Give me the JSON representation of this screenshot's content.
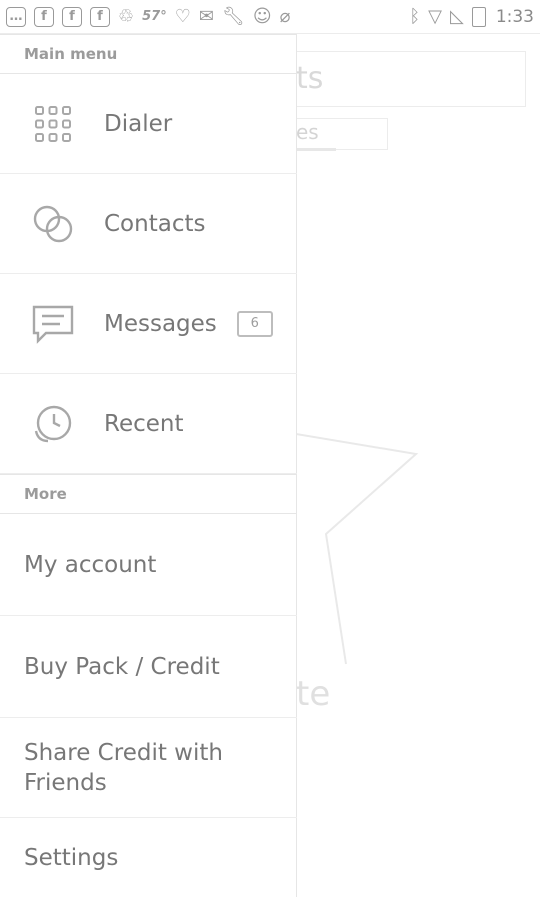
{
  "status_bar": {
    "left_icons": [
      "chat-icon",
      "facebook-icon",
      "facebook-icon",
      "facebook-icon",
      "recycle-icon",
      "temperature-icon",
      "heart-icon",
      "mail-icon",
      "wrench-icon",
      "messenger-icon",
      "pin-icon"
    ],
    "temperature": "57°",
    "time": "1:33"
  },
  "background": {
    "title_fragment": "ts",
    "tab_fragment": "es",
    "hint_fragment": "te"
  },
  "drawer": {
    "main_menu_header": "Main menu",
    "main_items": [
      {
        "label": "Dialer",
        "icon": "dialpad-icon"
      },
      {
        "label": "Contacts",
        "icon": "contacts-icon"
      },
      {
        "label": "Messages",
        "icon": "message-icon",
        "badge": "6"
      },
      {
        "label": "Recent",
        "icon": "recent-calls-icon"
      }
    ],
    "more_header": "More",
    "more_items": [
      {
        "label": "My account"
      },
      {
        "label": "Buy Pack / Credit"
      },
      {
        "label": "Share Credit with Friends"
      },
      {
        "label": "Settings"
      }
    ]
  },
  "colors": {
    "text": "#777777",
    "divider": "#e6e6e6",
    "icon": "#a8a8a8"
  }
}
